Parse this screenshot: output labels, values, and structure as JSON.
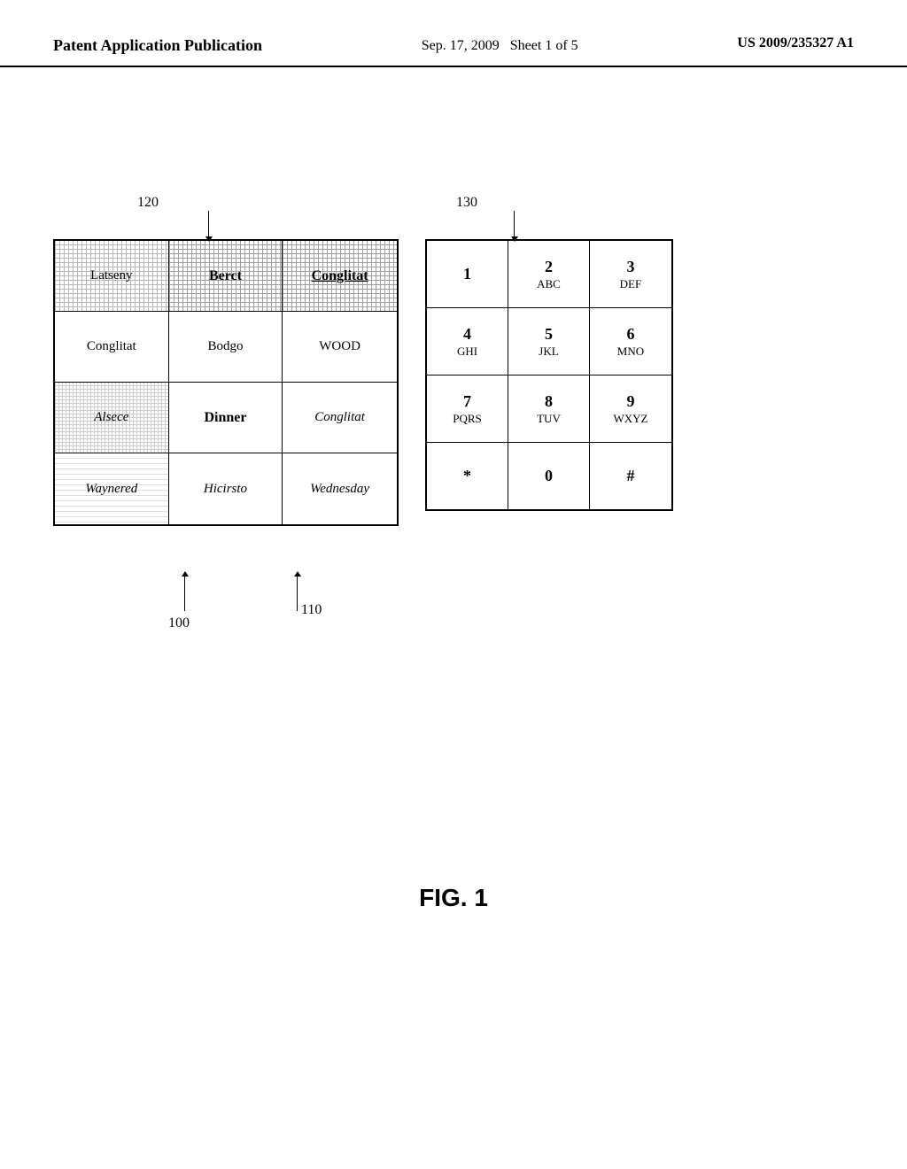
{
  "header": {
    "left": "Patent Application Publication",
    "center_line1": "Sep. 17, 2009",
    "center_line2": "Sheet 1 of 5",
    "right": "US 2009/235327 A1"
  },
  "labels": {
    "label_120": "120",
    "label_130": "130",
    "label_100": "100",
    "label_110": "110"
  },
  "left_panel": {
    "rows": [
      {
        "cells": [
          {
            "text": "Latseny",
            "style": "normal",
            "hatch": "hatch-dark"
          },
          {
            "text": "Berct",
            "style": "bold",
            "hatch": "hatch-dark-dense"
          },
          {
            "text": "Conglitat",
            "style": "bold-underline",
            "hatch": "hatch-dark-dense"
          }
        ]
      },
      {
        "cells": [
          {
            "text": "Conglitat",
            "style": "normal",
            "hatch": "none"
          },
          {
            "text": "Bodgo",
            "style": "normal",
            "hatch": "none"
          },
          {
            "text": "WOOD",
            "style": "normal",
            "hatch": "none"
          }
        ]
      },
      {
        "cells": [
          {
            "text": "Alsece",
            "style": "italic",
            "hatch": "hatch-medium"
          },
          {
            "text": "Dinner",
            "style": "bold",
            "hatch": "none"
          },
          {
            "text": "Conglitat",
            "style": "italic",
            "hatch": "none"
          }
        ]
      },
      {
        "cells": [
          {
            "text": "Waynered",
            "style": "italic",
            "hatch": "hatch-light"
          },
          {
            "text": "Hicirsto",
            "style": "italic",
            "hatch": "none"
          },
          {
            "text": "Wednesday",
            "style": "italic",
            "hatch": "none"
          }
        ]
      }
    ]
  },
  "right_panel": {
    "rows": [
      [
        {
          "num": "1",
          "letters": ""
        },
        {
          "num": "2",
          "letters": "ABC"
        },
        {
          "num": "3",
          "letters": "DEF"
        }
      ],
      [
        {
          "num": "4",
          "letters": "GHI"
        },
        {
          "num": "5",
          "letters": "JKL"
        },
        {
          "num": "6",
          "letters": "MNO"
        }
      ],
      [
        {
          "num": "7",
          "letters": "PQRS"
        },
        {
          "num": "8",
          "letters": "TUV"
        },
        {
          "num": "9",
          "letters": "WXYZ"
        }
      ],
      [
        {
          "num": "*",
          "letters": ""
        },
        {
          "num": "0",
          "letters": ""
        },
        {
          "num": "#",
          "letters": ""
        }
      ]
    ]
  },
  "fig_label": "FIG. 1"
}
